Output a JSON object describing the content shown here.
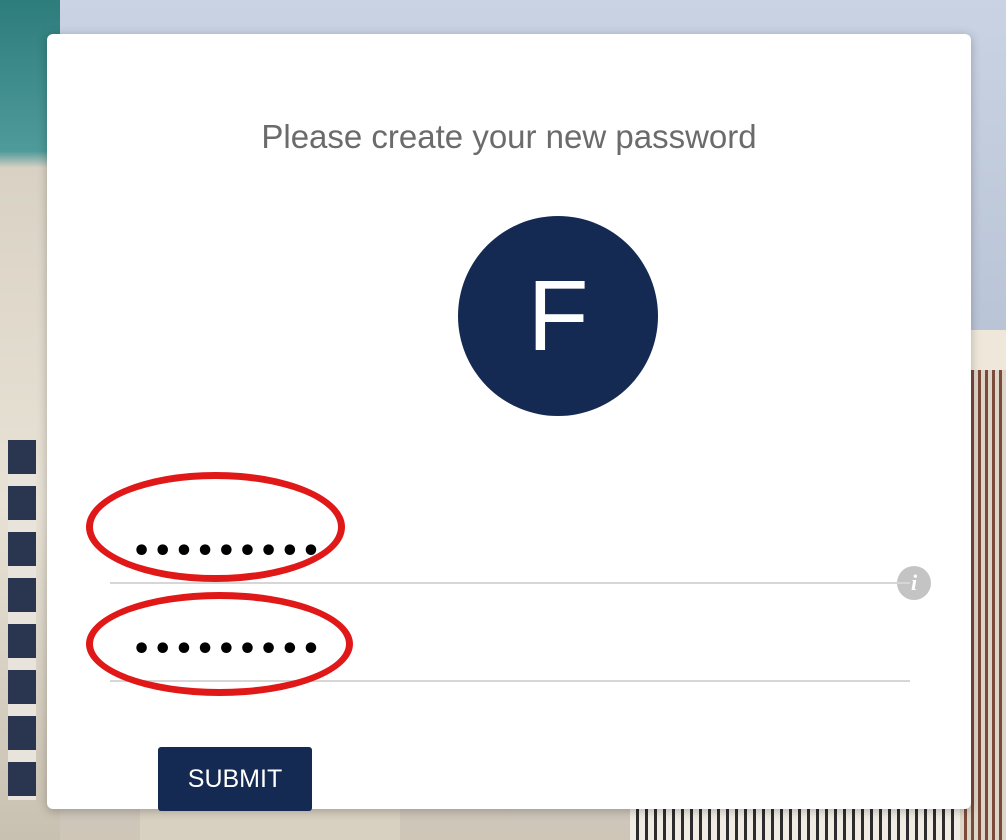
{
  "form": {
    "title": "Please create your new password",
    "avatar_letter": "F",
    "password_value": "•••••••••",
    "confirm_value": "•••••••••",
    "info_icon": "i",
    "submit_label": "SUBMIT"
  },
  "colors": {
    "accent": "#142a52",
    "highlight": "#e01818",
    "title_text": "#6b6b6b"
  },
  "icons": [
    "info-icon"
  ]
}
